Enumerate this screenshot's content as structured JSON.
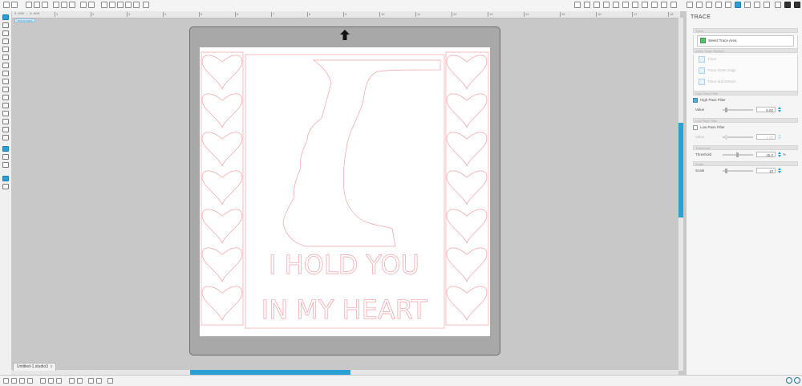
{
  "document": {
    "tab_name": "Untitled-1.studio3",
    "close_glyph": "x",
    "coords_readout": "0.000 : 8.000",
    "mode_chip": "TRACE AREA"
  },
  "ruler": {
    "ticks": [
      "1",
      "2",
      "3",
      "4",
      "5",
      "6",
      "7",
      "8",
      "9",
      "10",
      "11",
      "12",
      "13",
      "14",
      "15",
      "16",
      "17",
      "18"
    ]
  },
  "trace_panel": {
    "title": "TRACE",
    "sections": {
      "trace": {
        "heading": "Trace",
        "select_button": "Select Trace Area"
      },
      "apply": {
        "heading": "Apply Trace Method",
        "options": [
          "Trace",
          "Trace Outer Edge",
          "Trace and Detach"
        ]
      },
      "high_pass": {
        "heading": "High Pass Filter",
        "checkbox_label": "High Pass Filter",
        "checked": true,
        "value_label": "Value",
        "value": "5.00"
      },
      "low_pass": {
        "heading": "Low Pass Filter",
        "checkbox_label": "Low Pass Filter",
        "checked": false,
        "value_label": "Value",
        "value": "1.00"
      },
      "threshold": {
        "heading": "Threshold",
        "label": "Threshold",
        "value": "45.0",
        "unit": "%"
      },
      "scale": {
        "heading": "Scale",
        "label": "Scale",
        "value": "10"
      }
    }
  },
  "design": {
    "line_1": "I HOLD YOU",
    "line_2": "IN MY HEART",
    "stroke_color": "#f2a0a6"
  },
  "colors": {
    "accent": "#2aa0d6",
    "mat_gray": "#a8a8a8",
    "canvas_bg": "#c8c8c8"
  }
}
